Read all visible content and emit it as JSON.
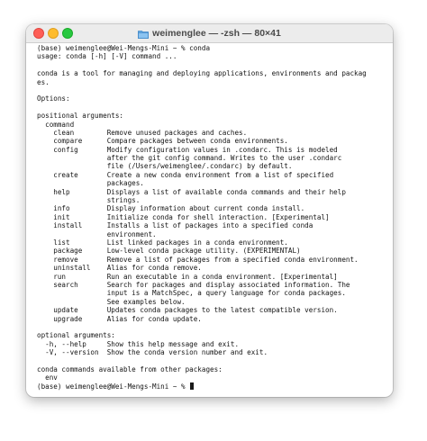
{
  "window": {
    "title": "weimenglee — -zsh — 80×41"
  },
  "terminal": {
    "lines": [
      "(base) weimenglee@Wei-Mengs-Mini ~ % conda",
      "usage: conda [-h] [-V] command ...",
      "",
      "conda is a tool for managing and deploying applications, environments and packag",
      "es.",
      "",
      "Options:",
      "",
      "positional arguments:",
      "  command",
      "    clean        Remove unused packages and caches.",
      "    compare      Compare packages between conda environments.",
      "    config       Modify configuration values in .condarc. This is modeled",
      "                 after the git config command. Writes to the user .condarc",
      "                 file (/Users/weimenglee/.condarc) by default.",
      "    create       Create a new conda environment from a list of specified",
      "                 packages.",
      "    help         Displays a list of available conda commands and their help",
      "                 strings.",
      "    info         Display information about current conda install.",
      "    init         Initialize conda for shell interaction. [Experimental]",
      "    install      Installs a list of packages into a specified conda",
      "                 environment.",
      "    list         List linked packages in a conda environment.",
      "    package      Low-level conda package utility. (EXPERIMENTAL)",
      "    remove       Remove a list of packages from a specified conda environment.",
      "    uninstall    Alias for conda remove.",
      "    run          Run an executable in a conda environment. [Experimental]",
      "    search       Search for packages and display associated information. The",
      "                 input is a MatchSpec, a query language for conda packages.",
      "                 See examples below.",
      "    update       Updates conda packages to the latest compatible version.",
      "    upgrade      Alias for conda update.",
      "",
      "optional arguments:",
      "  -h, --help     Show this help message and exit.",
      "  -V, --version  Show the conda version number and exit.",
      "",
      "conda commands available from other packages:",
      "  env"
    ],
    "prompt": "(base) weimenglee@Wei-Mengs-Mini ~ % "
  }
}
